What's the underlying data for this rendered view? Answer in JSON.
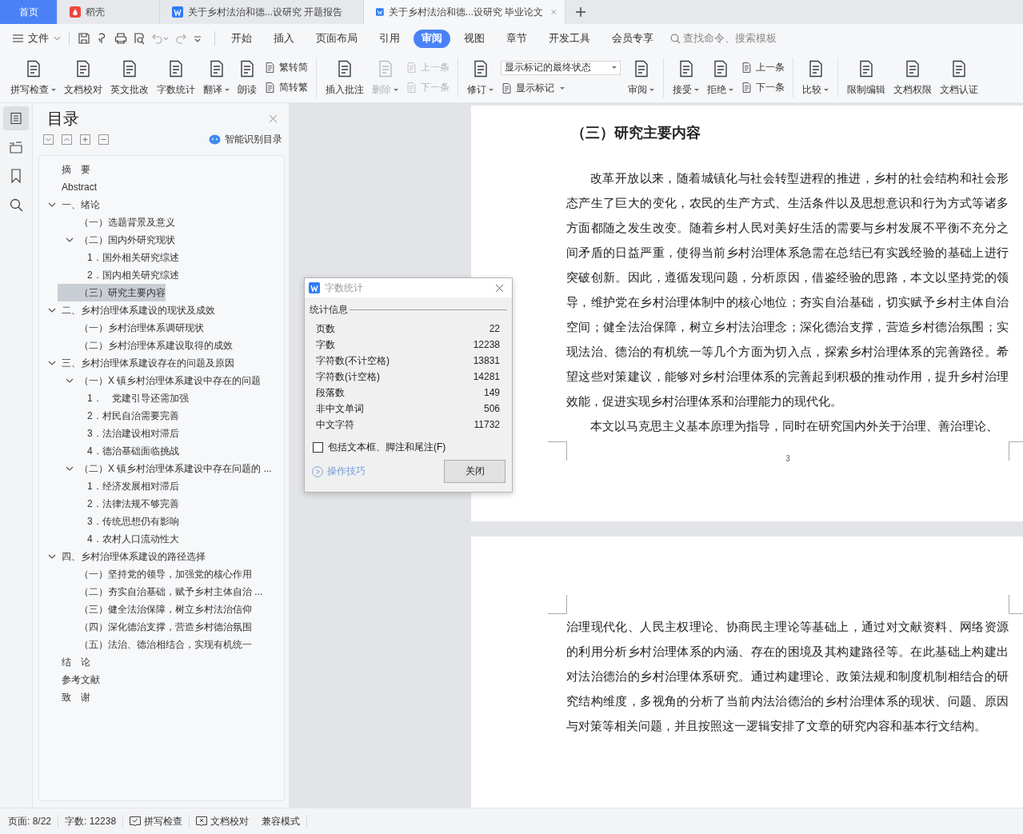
{
  "tab_bar": {
    "tabs": [
      {
        "label": "首页",
        "kind": "home",
        "selected": false
      },
      {
        "label": "稻壳",
        "kind": "docer",
        "selected": false
      },
      {
        "label": "关于乡村法治和德...设研究 开题报告",
        "kind": "document",
        "selected": false
      },
      {
        "label": "关于乡村法治和德...设研究 毕业论文",
        "kind": "document",
        "selected": true
      }
    ]
  },
  "menu_bar": {
    "file_label": "文件",
    "tabs": [
      {
        "label": "开始",
        "selected": false
      },
      {
        "label": "插入",
        "selected": false
      },
      {
        "label": "页面布局",
        "selected": false
      },
      {
        "label": "引用",
        "selected": false
      },
      {
        "label": "审阅",
        "selected": true
      },
      {
        "label": "视图",
        "selected": false
      },
      {
        "label": "章节",
        "selected": false
      },
      {
        "label": "开发工具",
        "selected": false
      },
      {
        "label": "会员专享",
        "selected": false
      }
    ],
    "search": {
      "placeholder": "查找命令、搜索模板"
    }
  },
  "ribbon": {
    "groups": [
      {
        "items": [
          {
            "kind": "big",
            "label": "拼写检查",
            "dropdown": true,
            "disabled": false
          },
          {
            "kind": "big",
            "label": "文档校对",
            "dropdown": false,
            "disabled": false
          },
          {
            "kind": "big",
            "label": "英文批改",
            "dropdown": false,
            "disabled": false
          },
          {
            "kind": "big",
            "label": "字数统计",
            "dropdown": false,
            "disabled": false
          },
          {
            "kind": "big",
            "label": "翻译",
            "dropdown": true,
            "disabled": false
          },
          {
            "kind": "big",
            "label": "朗读",
            "dropdown": false,
            "disabled": false
          },
          {
            "kind": "stack",
            "entries": [
              {
                "kind": "small",
                "label": "繁转简",
                "dropdown": false,
                "disabled": false
              },
              {
                "kind": "small",
                "label": "简转繁",
                "dropdown": false,
                "disabled": false
              }
            ]
          }
        ]
      },
      {
        "items": [
          {
            "kind": "big",
            "label": "插入批注",
            "dropdown": false,
            "disabled": false
          },
          {
            "kind": "big",
            "label": "删除",
            "dropdown": true,
            "disabled": true
          },
          {
            "kind": "stack",
            "entries": [
              {
                "kind": "small",
                "label": "上一条",
                "dropdown": false,
                "disabled": true
              },
              {
                "kind": "small",
                "label": "下一条",
                "dropdown": false,
                "disabled": true
              }
            ]
          }
        ]
      },
      {
        "items": [
          {
            "kind": "big",
            "label": "修订",
            "dropdown": true,
            "disabled": false
          },
          {
            "kind": "stack",
            "entries": [
              {
                "kind": "select",
                "value": "显示标记的最终状态"
              },
              {
                "kind": "small",
                "label": "显示标记",
                "dropdown": true,
                "disabled": false
              }
            ]
          },
          {
            "kind": "big",
            "label": "审阅",
            "dropdown": true,
            "disabled": false
          }
        ]
      },
      {
        "items": [
          {
            "kind": "big",
            "label": "接受",
            "dropdown": true,
            "disabled": false
          },
          {
            "kind": "big",
            "label": "拒绝",
            "dropdown": true,
            "disabled": false
          },
          {
            "kind": "stack",
            "entries": [
              {
                "kind": "small",
                "label": "上一条",
                "dropdown": false,
                "disabled": false
              },
              {
                "kind": "small",
                "label": "下一条",
                "dropdown": false,
                "disabled": false
              }
            ]
          }
        ]
      },
      {
        "items": [
          {
            "kind": "big",
            "label": "比较",
            "dropdown": true,
            "disabled": false
          }
        ]
      },
      {
        "items": [
          {
            "kind": "big",
            "label": "限制编辑",
            "dropdown": false,
            "disabled": false
          },
          {
            "kind": "big",
            "label": "文档权限",
            "dropdown": false,
            "disabled": false
          },
          {
            "kind": "big",
            "label": "文档认证",
            "dropdown": false,
            "disabled": false
          }
        ]
      }
    ]
  },
  "side_strip": {
    "items": [
      {
        "selected": true
      },
      {
        "selected": false
      },
      {
        "selected": false
      },
      {
        "selected": false
      }
    ]
  },
  "toc": {
    "title": "目录",
    "smart_button": "智能识别目录",
    "items": [
      {
        "label": "摘　要",
        "selected": false
      },
      {
        "label": "Abstract",
        "selected": false
      },
      {
        "label": "一、绪论",
        "selected": false,
        "expanded": true,
        "children": [
          {
            "label": "（一）选题背景及意义",
            "selected": false
          },
          {
            "label": "（二）国内外研究现状",
            "selected": false,
            "expanded": true,
            "children": [
              {
                "label": "1．国外相关研究综述",
                "selected": false
              },
              {
                "label": "2．国内相关研究综述",
                "selected": false
              }
            ]
          },
          {
            "label": "（三）研究主要内容",
            "selected": true
          }
        ]
      },
      {
        "label": "二、乡村治理体系建设的现状及成效",
        "selected": false,
        "expanded": true,
        "children": [
          {
            "label": "（一）乡村治理体系调研现状",
            "selected": false
          },
          {
            "label": "（二）乡村治理体系建设取得的成效",
            "selected": false
          }
        ]
      },
      {
        "label": "三、乡村治理体系建设存在的问题及原因",
        "selected": false,
        "expanded": true,
        "children": [
          {
            "label": "（一）X 镇乡村治理体系建设中存在的问题",
            "selected": false,
            "expanded": true,
            "children": [
              {
                "label": "1．　党建引导还需加强",
                "selected": false
              },
              {
                "label": "2．村民自治需要完善",
                "selected": false
              },
              {
                "label": "3．法治建设相对滞后",
                "selected": false
              },
              {
                "label": "4．德治基础面临挑战",
                "selected": false
              }
            ]
          },
          {
            "label": "（二）X 镇乡村治理体系建设中存在问题的 ...",
            "selected": false,
            "expanded": true,
            "children": [
              {
                "label": "1．经济发展相对滞后",
                "selected": false
              },
              {
                "label": "2．法律法规不够完善",
                "selected": false
              },
              {
                "label": "3．传统思想仍有影响",
                "selected": false
              },
              {
                "label": "4．农村人口流动性大",
                "selected": false
              }
            ]
          }
        ]
      },
      {
        "label": "四、乡村治理体系建设的路径选择",
        "selected": false,
        "expanded": true,
        "children": [
          {
            "label": "（一）坚持党的领导，加强党的核心作用",
            "selected": false
          },
          {
            "label": "（二）夯实自治基础，赋予乡村主体自治 ...",
            "selected": false
          },
          {
            "label": "（三）健全法治保障，树立乡村法治信仰",
            "selected": false
          },
          {
            "label": "（四）深化德治支撑，营造乡村德治氛围",
            "selected": false
          },
          {
            "label": "（五）法治、德治相结合，实现有机统一",
            "selected": false
          }
        ]
      },
      {
        "label": "结　论",
        "selected": false
      },
      {
        "label": "参考文献",
        "selected": false
      },
      {
        "label": "致　谢",
        "selected": false
      }
    ]
  },
  "document": {
    "pages": [
      {
        "heading": "（三）研究主要内容",
        "paragraphs": [
          {
            "kind": "paragraph",
            "text": "改革开放以来，随着城镇化与社会转型进程的推进，乡村的社会结构和社会形态产生了巨大的变化，农民的生产方式、生活条件以及思想意识和行为方式等诸多方面都随之发生改变。随着乡村人民对美好生活的需要与乡村发展不平衡不充分之间矛盾的日益严重，使得当前乡村治理体系急需在总结已有实践经验的基础上进行突破创新。因此，遵循发现问题，分析原因，借鉴经验的思路，本文以坚持党的领导，维护党在乡村治理体制中的核心地位；夯实自治基础，切实赋予乡村主体自治空间；健全法治保障，树立乡村法治理念；深化德治支撑，营造乡村德治氛围；实现法治、德治的有机统一等几个方面为切入点，探索乡村治理体系的完善路径。希望这些对策建议，能够对乡村治理体系的完善起到积极的推动作用，提升乡村治理效能，促进实现乡村治理体系和治理能力的现代化。"
          },
          {
            "kind": "paragraph",
            "text": "本文以马克思主义基本原理为指导，同时在研究国内外关于治理、善治理论、"
          }
        ],
        "page_number": "3"
      },
      {
        "paragraphs": [
          {
            "kind": "continuation",
            "text": "治理现代化、人民主权理论、协商民主理论等基础上，通过对文献资料、网络资源的利用分析乡村治理体系的内涵、存在的困境及其构建路径等。在此基础上构建出对法治德治的乡村治理体系研究。通过构建理论、政策法规和制度机制相结合的研究结构维度，多视角的分析了当前内法治德治的乡村治理体系的现状、问题、原因与对策等相关问题，并且按照这一逻辑安排了文章的研究内容和基本行文结构。"
          }
        ]
      }
    ]
  },
  "word_count_dialog": {
    "title": "字数统计",
    "group_label": "统计信息",
    "rows": [
      {
        "label": "页数",
        "value": "22"
      },
      {
        "label": "字数",
        "value": "12238"
      },
      {
        "label": "字符数(不计空格)",
        "value": "13831"
      },
      {
        "label": "字符数(计空格)",
        "value": "14281"
      },
      {
        "label": "段落数",
        "value": "149"
      },
      {
        "label": "非中文单词",
        "value": "506"
      },
      {
        "label": "中文字符",
        "value": "11732"
      }
    ],
    "include_option": {
      "label": "包括文本框、脚注和尾注(F)",
      "checked": false
    },
    "tips_link": "操作技巧",
    "close_button": "关闭"
  },
  "status_bar": {
    "page": "页面: 8/22",
    "word_count": "字数: 12238",
    "spell_check": "拼写检查",
    "proofread": "文档校对",
    "mode": "兼容模式"
  }
}
